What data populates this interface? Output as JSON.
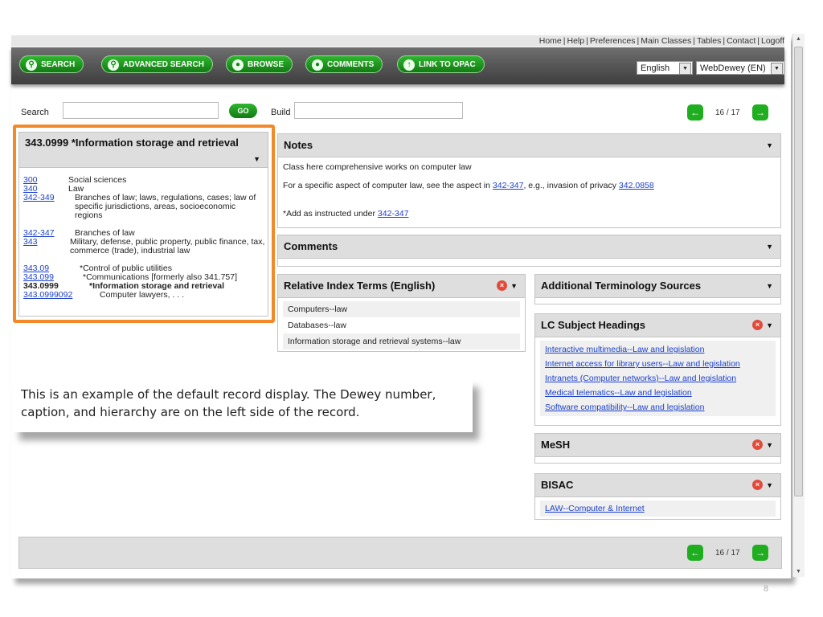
{
  "top_links": [
    "Home",
    "Help",
    "Preferences",
    "Main Classes",
    "Tables",
    "Contact",
    "Logoff"
  ],
  "toolbar": {
    "buttons": [
      "SEARCH",
      "ADVANCED SEARCH",
      "BROWSE",
      "COMMENTS",
      "LINK TO OPAC"
    ],
    "language": "English",
    "edition": "WebDewey (EN)"
  },
  "search": {
    "label": "Search",
    "value": "",
    "go": "GO",
    "build_label": "Build",
    "build_value": ""
  },
  "pager": {
    "text": "16 / 17"
  },
  "record": {
    "title": "343.0999 *Information storage and retrieval",
    "hierarchy": [
      {
        "num": "300",
        "text": "Social sciences"
      },
      {
        "num": "340",
        "text": "Law"
      },
      {
        "num": "342-349",
        "text": "Branches of law; laws, regulations, cases; law of specific jurisdictions, areas, socioeconomic regions"
      },
      {
        "num": "342-347",
        "text": "Branches of law"
      },
      {
        "num": "343",
        "text": "Military, defense, public property, public finance, tax, commerce (trade), industrial law"
      },
      {
        "num": "343.09",
        "text": "*Control of public utilities"
      },
      {
        "num": "343.099",
        "text": "*Communications [formerly also 341.757]"
      },
      {
        "num": "343.0999",
        "text": "*Information storage and retrieval"
      },
      {
        "num": "343.0999092",
        "text": "Computer lawyers, . . ."
      }
    ]
  },
  "notes": {
    "title": "Notes",
    "line1": "Class here comprehensive works on computer law",
    "line2_pre": "For a specific aspect of computer law, see the aspect in ",
    "line2_link1": "342-347",
    "line2_mid": ", e.g., invasion of privacy ",
    "line2_link2": "342.0858",
    "line3_pre": "*Add as instructed under ",
    "line3_link": "342-347"
  },
  "comments": {
    "title": "Comments"
  },
  "relative_index": {
    "title": "Relative Index Terms (English)",
    "items": [
      "Computers--law",
      "Databases--law",
      "Information storage and retrieval systems--law"
    ]
  },
  "additional": {
    "title": "Additional Terminology Sources"
  },
  "lcsh": {
    "title": "LC Subject Headings",
    "items": [
      "Interactive multimedia--Law and legislation",
      "Internet access for library users--Law and legislation",
      "Intranets (Computer networks)--Law and legislation",
      "Medical telematics--Law and legislation",
      "Software compatibility--Law and legislation"
    ]
  },
  "mesh": {
    "title": "MeSH"
  },
  "bisac": {
    "title": "BISAC",
    "items": [
      "LAW--Computer & Internet"
    ]
  },
  "callout": {
    "line1": "This is an example of the default record display. The Dewey number,",
    "line2": "caption, and hierarchy are on the left side of the record."
  },
  "slide_number": "8",
  "colors": {
    "accent_green": "#1fae1f",
    "highlight_orange": "#f28a2a",
    "link_blue": "#1a3fcc"
  }
}
